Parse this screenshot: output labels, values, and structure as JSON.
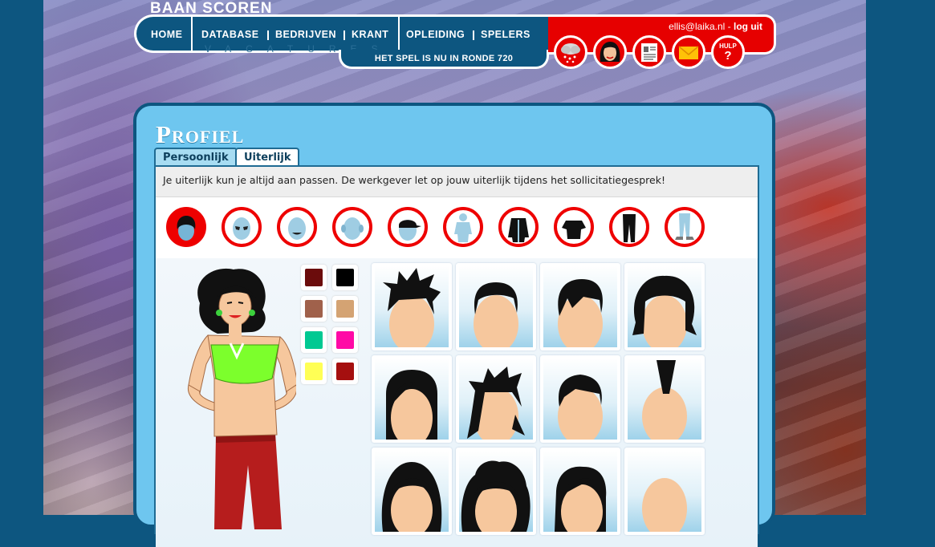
{
  "site": {
    "logo": "BAAN SCOREN"
  },
  "nav": {
    "items": [
      "HOME",
      "DATABASE",
      "BEDRIJVEN",
      "KRANT",
      "OPLEIDING",
      "SPELERS"
    ],
    "sub": "VACATURES",
    "round_text": "HET SPEL IS NU IN RONDE 720"
  },
  "user": {
    "email": "ellis@laika.nl",
    "separator": " - ",
    "logout": "log uit"
  },
  "toolbar": {
    "icons": [
      "weather-icon",
      "avatar-icon",
      "id-card-icon",
      "mail-icon",
      "help-icon"
    ],
    "help_label": "HULP",
    "help_symbol": "?"
  },
  "profile": {
    "title": "Profiel",
    "tabs": [
      "Persoonlijk",
      "Uiterlijk"
    ],
    "active_tab": "Uiterlijk",
    "info": "Je uiterlijk kun je altijd aan passen. De werkgever let op jouw uiterlijk tijdens het sollicitatiegesprek!",
    "categories": [
      "hair",
      "eyes",
      "mouth",
      "ears",
      "cap",
      "body",
      "jacket",
      "shirt",
      "pants",
      "shoes"
    ],
    "active_category": "hair",
    "colors": [
      "#6b0c0c",
      "#000000",
      "#a0614b",
      "#d4a373",
      "#00c992",
      "#ff0aa6",
      "#ffff55",
      "#a50f0f"
    ],
    "hairstyles_count": 12
  }
}
